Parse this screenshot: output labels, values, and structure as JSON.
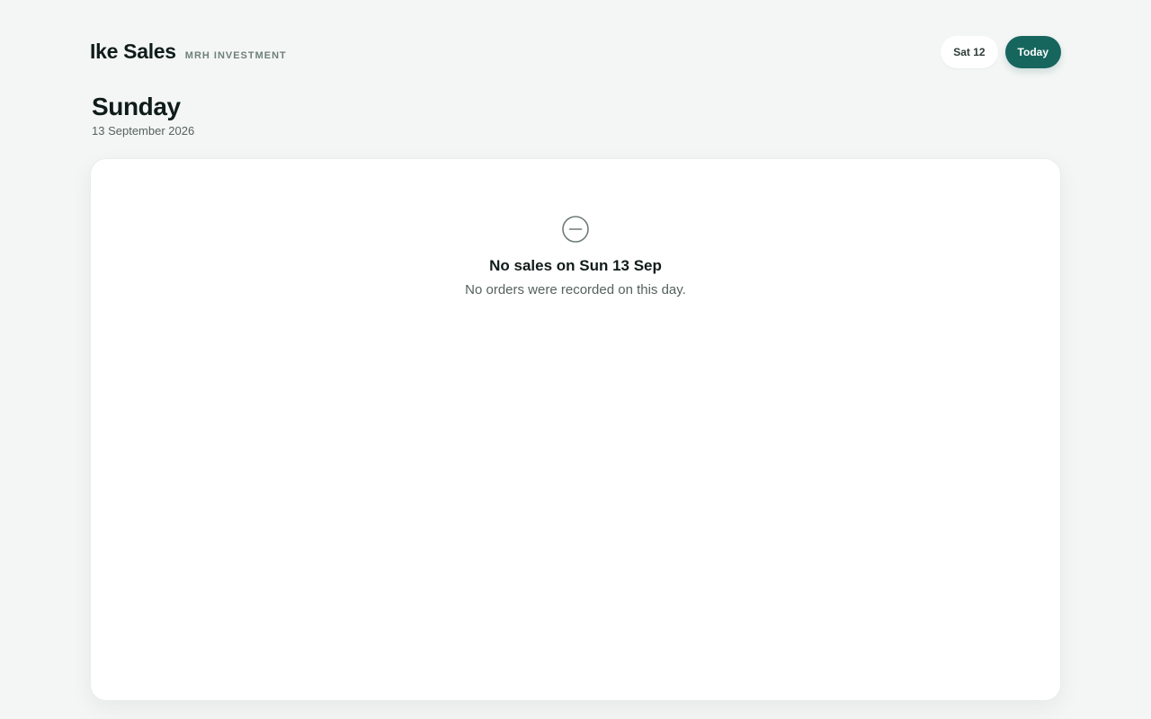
{
  "header": {
    "brand_name": "Ike Sales",
    "brand_subtitle": "MRH INVESTMENT",
    "prev_day_label": "Sat 12",
    "today_label": "Today"
  },
  "day": {
    "weekday": "Sunday",
    "date": "13 September 2026"
  },
  "empty_state": {
    "icon": "minus-circle-icon",
    "title": "No sales on Sun 13 Sep",
    "description": "No orders were recorded on this day."
  },
  "colors": {
    "background": "#f4f6f5",
    "accent": "#17665e",
    "card": "#ffffff",
    "text_primary": "#0f1c1a",
    "text_muted": "#55625f"
  }
}
